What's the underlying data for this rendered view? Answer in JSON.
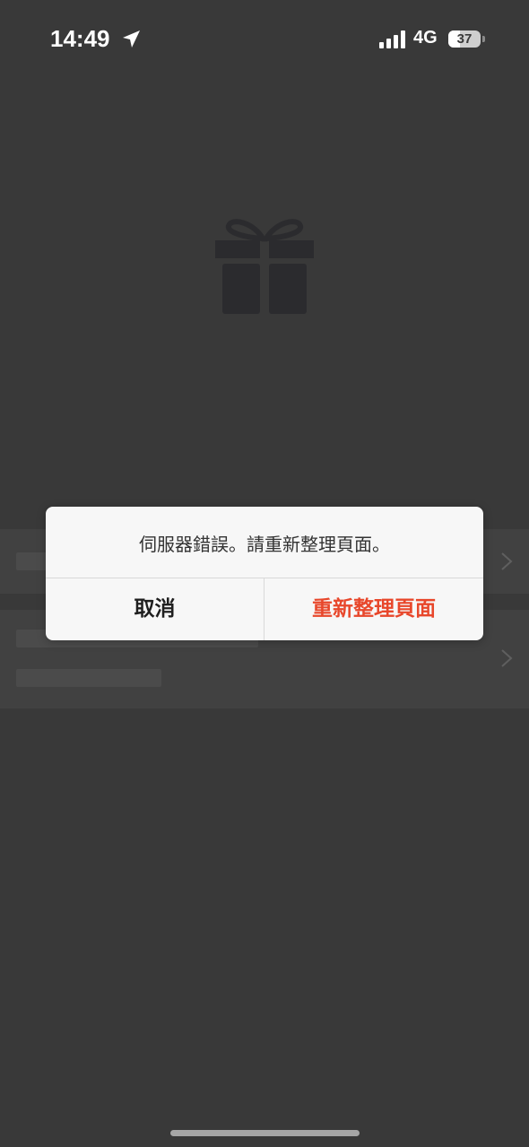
{
  "status_bar": {
    "time": "14:49",
    "network": "4G",
    "battery_level": "37",
    "location_icon": "location-arrow-icon",
    "signal_icon": "cellular-signal-icon"
  },
  "background": {
    "icon": "gift-icon"
  },
  "dialog": {
    "message": "伺服器錯誤。請重新整理頁面。",
    "cancel_label": "取消",
    "refresh_label": "重新整理頁面",
    "accent_color": "#e8472b"
  }
}
